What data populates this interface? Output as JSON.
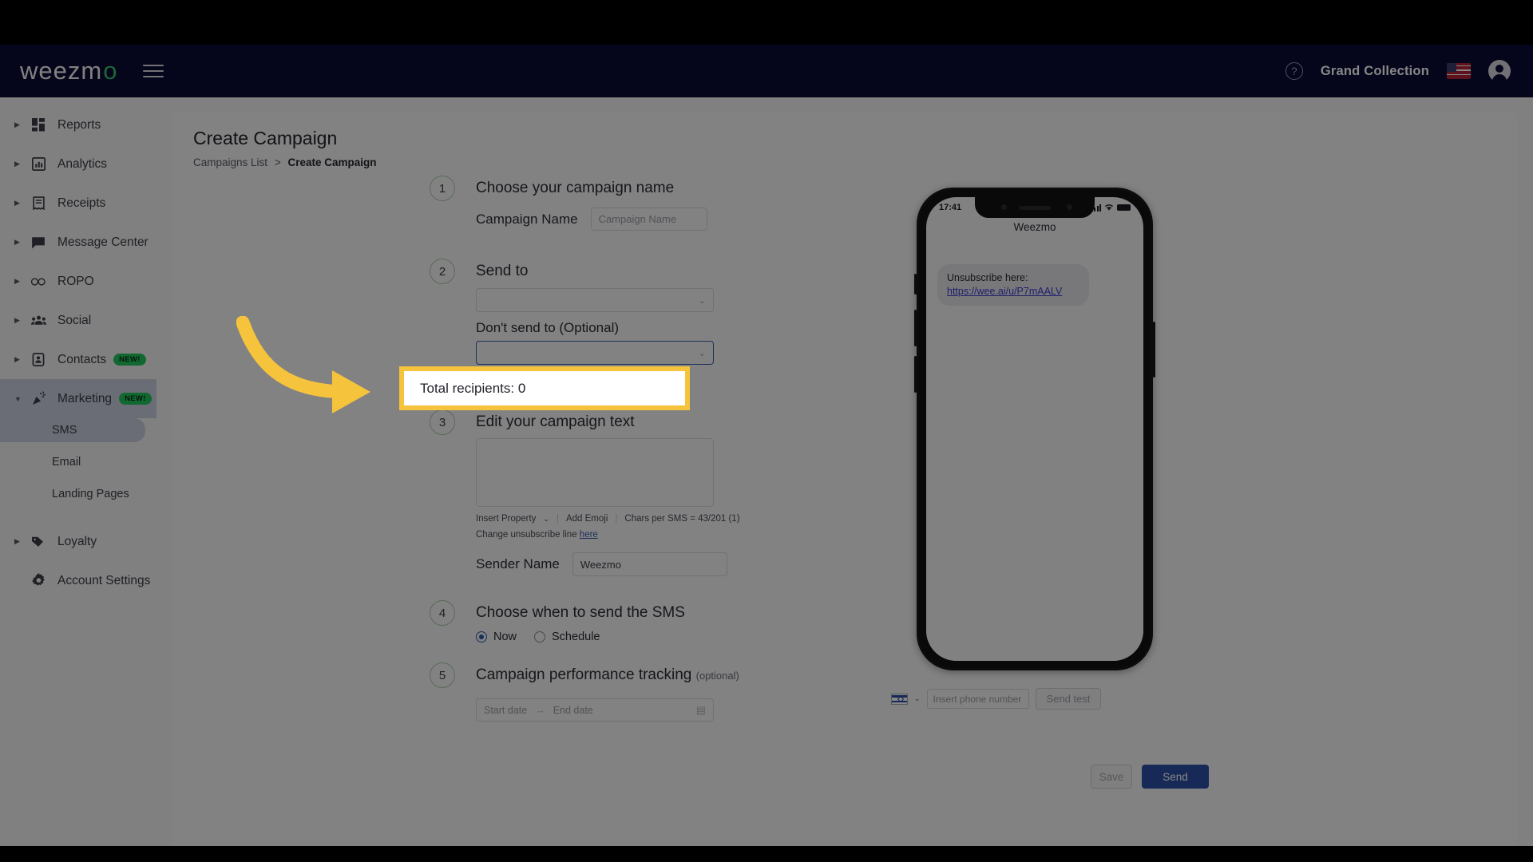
{
  "topbar": {
    "logo_main": "weezm",
    "logo_tail": "o",
    "menu_icon": "hamburger-icon",
    "help_icon": "?",
    "account_name": "Grand Collection",
    "flag": "us-flag",
    "avatar": "account-avatar"
  },
  "sidebar": {
    "items": [
      {
        "label": "Reports",
        "icon": "dashboard-icon",
        "expandable": true,
        "badge": ""
      },
      {
        "label": "Analytics",
        "icon": "chart-icon",
        "expandable": true,
        "badge": ""
      },
      {
        "label": "Receipts",
        "icon": "receipt-icon",
        "expandable": true,
        "badge": ""
      },
      {
        "label": "Message Center",
        "icon": "chat-icon",
        "expandable": true,
        "badge": ""
      },
      {
        "label": "ROPO",
        "icon": "infinity-icon",
        "expandable": true,
        "badge": ""
      },
      {
        "label": "Social",
        "icon": "people-icon",
        "expandable": true,
        "badge": ""
      },
      {
        "label": "Contacts",
        "icon": "contact-card-icon",
        "expandable": true,
        "badge": "NEW!"
      },
      {
        "label": "Marketing",
        "icon": "megaphone-icon",
        "expandable": true,
        "badge": "NEW!"
      }
    ],
    "marketing_children": [
      {
        "label": "SMS",
        "selected": true
      },
      {
        "label": "Email",
        "selected": false
      },
      {
        "label": "Landing Pages",
        "selected": false
      }
    ],
    "footer_items": [
      {
        "label": "Loyalty",
        "icon": "tag-icon",
        "expandable": true
      },
      {
        "label": "Account Settings",
        "icon": "gear-icon",
        "expandable": false
      }
    ]
  },
  "page": {
    "title": "Create Campaign",
    "breadcrumb_parent": "Campaigns List",
    "breadcrumb_sep": ">",
    "breadcrumb_current": "Create Campaign"
  },
  "form": {
    "step1": {
      "number": "1",
      "title": "Choose your campaign name",
      "field_label": "Campaign Name",
      "field_placeholder": "Campaign Name",
      "field_value": ""
    },
    "step2": {
      "number": "2",
      "title": "Send to",
      "send_to_value": "",
      "dont_send_label": "Don't send to (Optional)",
      "dont_send_value": "",
      "total_recipients": "Total recipients: 0"
    },
    "step3": {
      "number": "3",
      "title": "Edit your campaign text",
      "message_value": "",
      "insert_property": "Insert Property",
      "add_emoji": "Add Emoji",
      "chars_counter": "Chars per SMS = 43/201 (1)",
      "unsubscribe_text": "Change unsubscribe line",
      "unsubscribe_link": "here",
      "sender_label": "Sender Name",
      "sender_value": "Weezmo"
    },
    "step4": {
      "number": "4",
      "title": "Choose when to send the SMS",
      "option_now": "Now",
      "option_schedule": "Schedule",
      "selected": "Now"
    },
    "step5": {
      "number": "5",
      "title": "Campaign performance tracking",
      "optional_tag": "(optional)",
      "start_placeholder": "Start date",
      "end_placeholder": "End date",
      "range_arrow": "→",
      "calendar_icon": "calendar-icon"
    }
  },
  "preview": {
    "status_time": "17:41",
    "phone_title": "Weezmo",
    "message_line1": "Unsubscribe here:",
    "message_link": "https://wee.ai/u/P7mAALV",
    "country_flag": "il-flag",
    "phone_placeholder": "Insert phone number",
    "send_test_label": "Send test"
  },
  "actions": {
    "save_label": "Save",
    "send_label": "Send"
  },
  "annotation": {
    "highlight_text": "Total recipients: 0",
    "highlight_color": "#f6c33c",
    "arrow_color": "#f6c33c"
  }
}
